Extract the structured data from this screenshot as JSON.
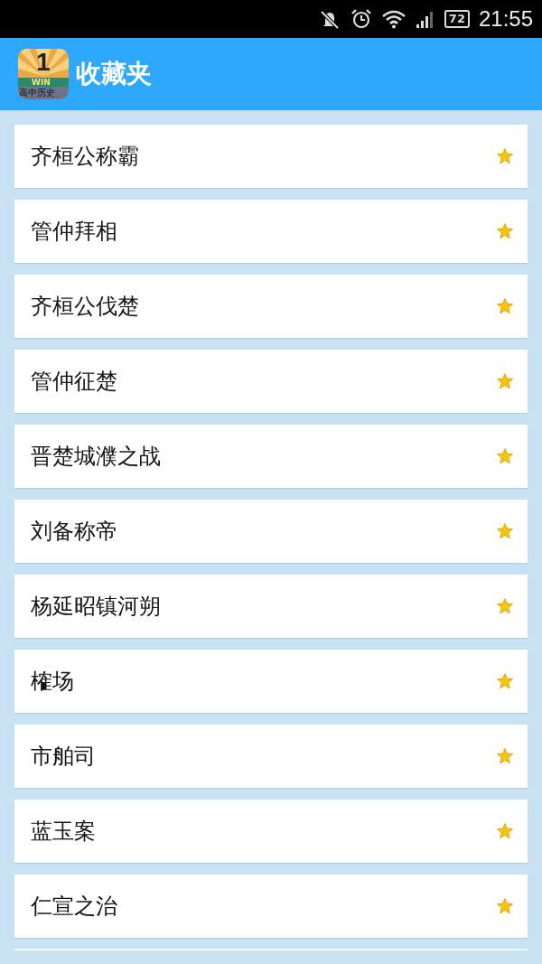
{
  "status_bar": {
    "battery": "72",
    "time": "21:55"
  },
  "header": {
    "app_icon": {
      "rank": "1",
      "badge": "WIN",
      "caption": "高中历史"
    },
    "title": "收藏夹"
  },
  "favorites": [
    {
      "title": "齐桓公称霸"
    },
    {
      "title": "管仲拜相"
    },
    {
      "title": "齐桓公伐楚"
    },
    {
      "title": "管仲征楚"
    },
    {
      "title": "晋楚城濮之战"
    },
    {
      "title": "刘备称帝"
    },
    {
      "title": "杨延昭镇河朔"
    },
    {
      "title": "榷场"
    },
    {
      "title": "市舶司"
    },
    {
      "title": "蓝玉案"
    },
    {
      "title": "仁宣之治"
    }
  ]
}
